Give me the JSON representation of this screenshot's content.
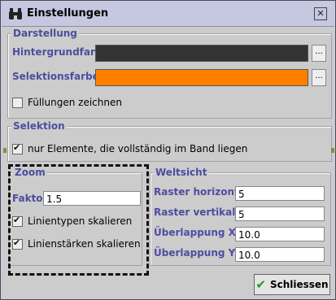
{
  "window": {
    "title": "Einstellungen",
    "close_glyph": "✕",
    "icon": "binoculars-icon"
  },
  "darstellung": {
    "title": "Darstellung",
    "hintergrund_label": "Hintergrundfarbe",
    "hintergrund_color": "#333333",
    "selektion_label": "Selektionsfarbe",
    "selektion_color": "#ff8000",
    "dots_label": "...",
    "fill_label": "Füllungen zeichnen",
    "fill_checked": false
  },
  "selektion": {
    "title": "Selektion",
    "only_label": "nur Elemente, die vollständig im Band liegen",
    "only_checked": true
  },
  "zoom": {
    "title": "Zoom",
    "faktor_label": "Faktor",
    "faktor_value": "1.5",
    "linientypen_label": "Linientypen skalieren",
    "linientypen_checked": true,
    "linienstaerken_label": "Linienstärken skalieren",
    "linienstaerken_checked": true
  },
  "weltsicht": {
    "title": "Weltsicht",
    "rows": [
      {
        "label": "Raster horizontal",
        "value": "5"
      },
      {
        "label": "Raster vertikal",
        "value": "5"
      },
      {
        "label": "Überlappung X",
        "value": "10.0"
      },
      {
        "label": "Überlappung Y",
        "value": "10.0"
      }
    ]
  },
  "footer": {
    "close_label": "Schliessen",
    "close_icon": "check-icon"
  },
  "colors": {
    "accent_text": "#4d4da0",
    "titlebar": "#c6c7e0",
    "window_bg": "#cccccc"
  }
}
